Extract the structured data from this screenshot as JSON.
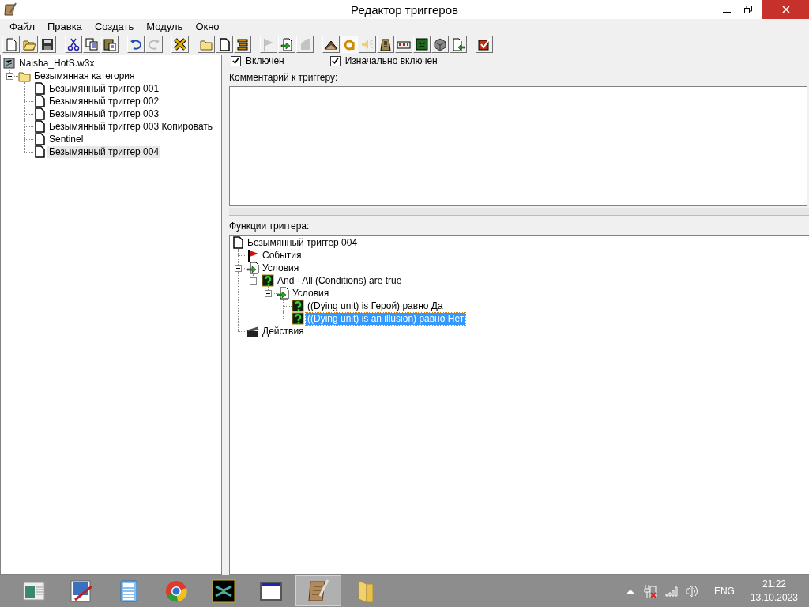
{
  "window": {
    "title": "Редактор триггеров"
  },
  "menu": [
    "Файл",
    "Правка",
    "Создать",
    "Модуль",
    "Окно"
  ],
  "toolbar": [
    {
      "buttons": [
        {
          "disabled": false,
          "selected": false
        },
        {
          "disabled": false,
          "selected": false
        },
        {
          "disabled": false,
          "selected": false
        }
      ]
    },
    {
      "buttons": [
        {
          "disabled": false,
          "selected": false
        },
        {
          "disabled": false,
          "selected": false
        },
        {
          "disabled": false,
          "selected": false
        }
      ]
    },
    {
      "buttons": [
        {
          "disabled": false,
          "selected": false
        },
        {
          "disabled": true,
          "selected": false
        }
      ]
    },
    {
      "buttons": [
        {
          "disabled": false,
          "selected": false
        }
      ]
    },
    {
      "buttons": [
        {
          "disabled": false,
          "selected": false
        },
        {
          "disabled": false,
          "selected": false
        },
        {
          "disabled": false,
          "selected": false
        }
      ]
    },
    {
      "buttons": [
        {
          "disabled": true,
          "selected": false
        },
        {
          "disabled": false,
          "selected": false
        },
        {
          "disabled": true,
          "selected": false
        }
      ]
    },
    {
      "buttons": [
        {
          "disabled": false,
          "selected": false
        },
        {
          "disabled": false,
          "selected": true
        },
        {
          "disabled": false,
          "selected": false
        },
        {
          "disabled": false,
          "selected": false
        },
        {
          "disabled": false,
          "selected": false
        },
        {
          "disabled": false,
          "selected": false
        },
        {
          "disabled": false,
          "selected": false
        },
        {
          "disabled": false,
          "selected": false
        }
      ]
    },
    {
      "buttons": [
        {
          "disabled": false,
          "selected": false
        }
      ]
    }
  ],
  "trigger_tree": [
    {
      "label": "Naisha_HotS.w3x",
      "kind": "map",
      "selected": false,
      "children": [
        {
          "label": "Безымянная категория",
          "kind": "folder",
          "expanded": true,
          "selected": false,
          "children": [
            {
              "label": "Безымянный триггер 001",
              "kind": "trigger",
              "selected": false
            },
            {
              "label": "Безымянный триггер 002",
              "kind": "trigger",
              "selected": false
            },
            {
              "label": "Безымянный триггер 003",
              "kind": "trigger",
              "selected": false
            },
            {
              "label": "Безымянный триггер 003 Копировать",
              "kind": "trigger",
              "selected": false
            },
            {
              "label": "Sentinel",
              "kind": "trigger",
              "selected": false
            },
            {
              "label": "Безымянный триггер 004",
              "kind": "trigger",
              "selected": true
            }
          ]
        }
      ]
    }
  ],
  "options": [
    {
      "label": "Включен",
      "checked": true
    },
    {
      "label": "Изначально включен",
      "checked": true
    }
  ],
  "comment": {
    "label": "Комментарий к триггеру:"
  },
  "functions": {
    "label": "Функции триггера:",
    "tree": [
      {
        "label": "Безымянный триггер 004",
        "kind": "trigger",
        "selected": false,
        "children": [
          {
            "label": "События",
            "kind": "event",
            "selected": false
          },
          {
            "label": "Условия",
            "kind": "conditions",
            "expanded": true,
            "selected": false,
            "children": [
              {
                "label": "And - All (Conditions) are true",
                "kind": "condition",
                "expanded": true,
                "selected": false,
                "children": [
                  {
                    "label": "Условия",
                    "kind": "conditions",
                    "expanded": true,
                    "selected": false,
                    "children": [
                      {
                        "label": "((Dying unit) is Герой) равно Да",
                        "kind": "condition",
                        "selected": false
                      },
                      {
                        "label": "((Dying unit) is an illusion) равно Нет",
                        "kind": "condition",
                        "selected": true
                      }
                    ]
                  }
                ]
              }
            ]
          },
          {
            "label": "Действия",
            "kind": "action",
            "selected": false
          }
        ]
      }
    ]
  },
  "taskbar": {
    "apps": [
      {
        "selected": false
      },
      {
        "selected": false
      },
      {
        "selected": false
      },
      {
        "selected": false
      },
      {
        "selected": false
      },
      {
        "selected": false
      },
      {
        "selected": true
      },
      {
        "selected": false
      }
    ],
    "language": "ENG",
    "time": "21:22",
    "date": "13.10.2023"
  }
}
